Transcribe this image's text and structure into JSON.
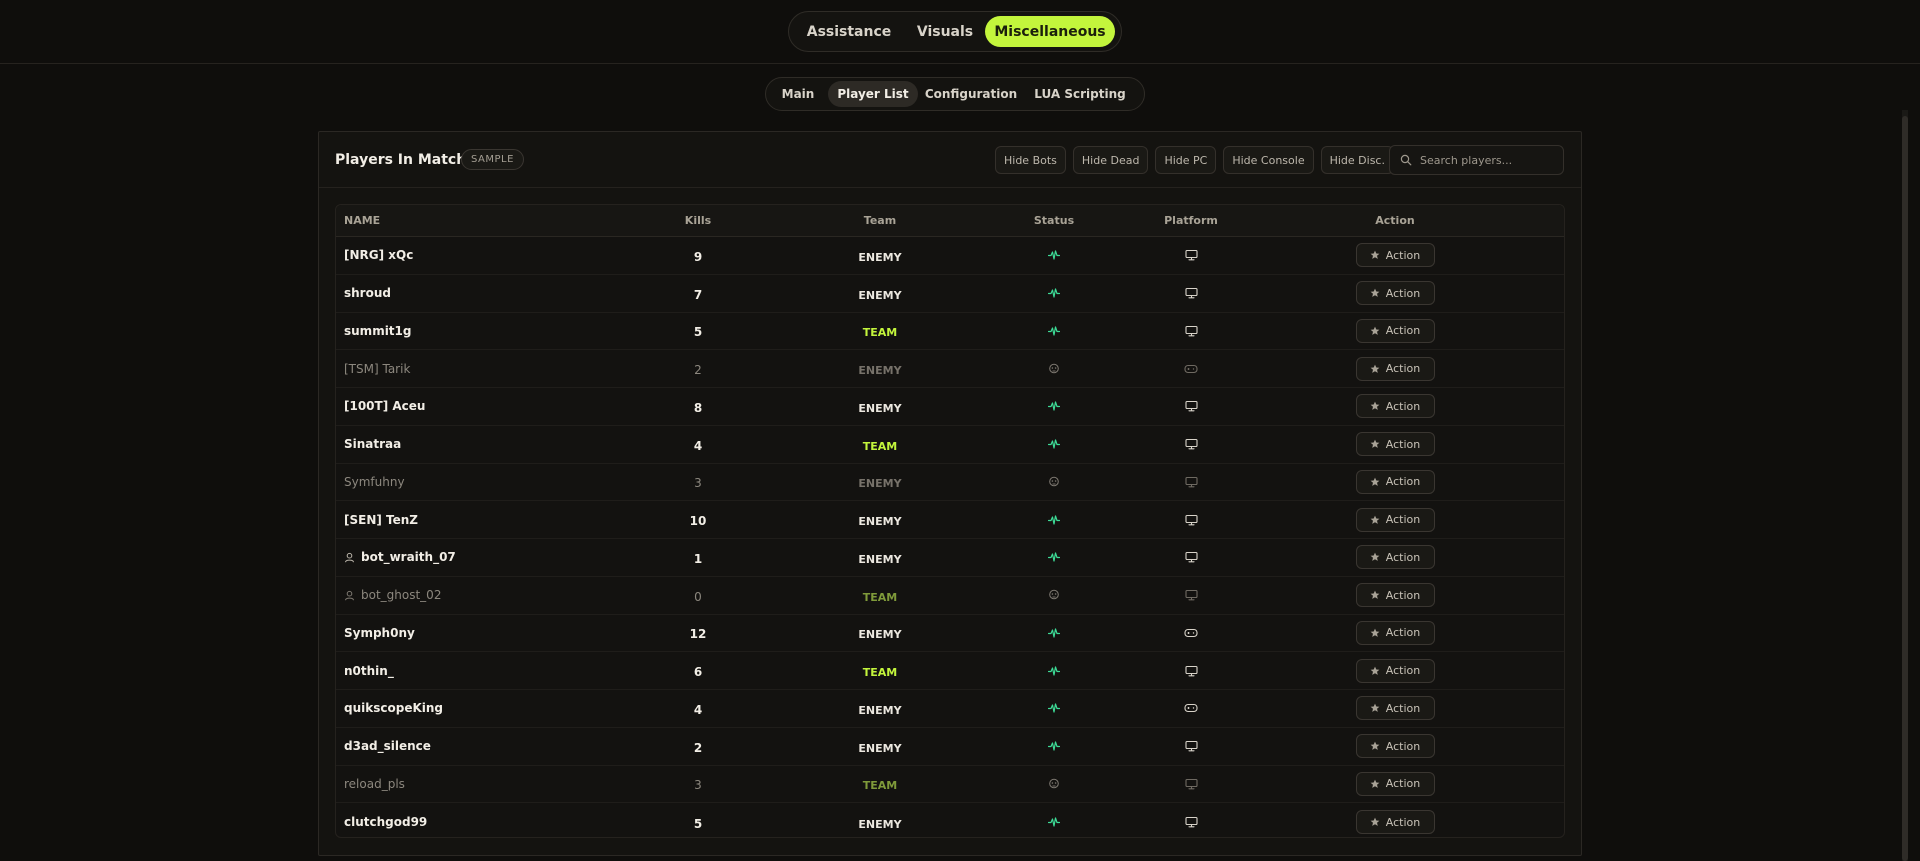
{
  "top_tabs": [
    {
      "label": "Assistance",
      "active": false
    },
    {
      "label": "Visuals",
      "active": false
    },
    {
      "label": "Miscellaneous",
      "active": true
    }
  ],
  "sub_tabs": [
    {
      "label": "Main",
      "active": false
    },
    {
      "label": "Player List",
      "active": true
    },
    {
      "label": "Configuration",
      "active": false
    },
    {
      "label": "LUA Scripting",
      "active": false
    }
  ],
  "panel": {
    "title": "Players In Match",
    "badge": "SAMPLE",
    "filters": [
      "Hide Bots",
      "Hide Dead",
      "Hide PC",
      "Hide Console",
      "Hide Disc."
    ],
    "search_placeholder": "Search players..."
  },
  "table": {
    "headers": {
      "name": "NAME",
      "kills": "Kills",
      "team": "Team",
      "status": "Status",
      "platform": "Platform",
      "action": "Action"
    },
    "action_label": "Action",
    "rows": [
      {
        "name": "[NRG] xQc",
        "kills": "9",
        "team": "ENEMY",
        "status": "alive",
        "platform": "pc",
        "bot": false
      },
      {
        "name": "shroud",
        "kills": "7",
        "team": "ENEMY",
        "status": "alive",
        "platform": "pc",
        "bot": false
      },
      {
        "name": "summit1g",
        "kills": "5",
        "team": "TEAM",
        "status": "alive",
        "platform": "pc",
        "bot": false
      },
      {
        "name": "[TSM] Tarik",
        "kills": "2",
        "team": "ENEMY",
        "status": "dead",
        "platform": "console",
        "bot": false
      },
      {
        "name": "[100T] Aceu",
        "kills": "8",
        "team": "ENEMY",
        "status": "alive",
        "platform": "pc",
        "bot": false
      },
      {
        "name": "Sinatraa",
        "kills": "4",
        "team": "TEAM",
        "status": "alive",
        "platform": "pc",
        "bot": false
      },
      {
        "name": "Symfuhny",
        "kills": "3",
        "team": "ENEMY",
        "status": "dead",
        "platform": "pc",
        "bot": false
      },
      {
        "name": "[SEN] TenZ",
        "kills": "10",
        "team": "ENEMY",
        "status": "alive",
        "platform": "pc",
        "bot": false
      },
      {
        "name": "bot_wraith_07",
        "kills": "1",
        "team": "ENEMY",
        "status": "alive",
        "platform": "pc",
        "bot": true
      },
      {
        "name": "bot_ghost_02",
        "kills": "0",
        "team": "TEAM",
        "status": "dead",
        "platform": "pc",
        "bot": true
      },
      {
        "name": "Symph0ny",
        "kills": "12",
        "team": "ENEMY",
        "status": "alive",
        "platform": "console",
        "bot": false
      },
      {
        "name": "n0thin_",
        "kills": "6",
        "team": "TEAM",
        "status": "alive",
        "platform": "pc",
        "bot": false
      },
      {
        "name": "quikscopeKing",
        "kills": "4",
        "team": "ENEMY",
        "status": "alive",
        "platform": "console",
        "bot": false
      },
      {
        "name": "d3ad_silence",
        "kills": "2",
        "team": "ENEMY",
        "status": "alive",
        "platform": "pc",
        "bot": false
      },
      {
        "name": "reload_pls",
        "kills": "3",
        "team": "TEAM",
        "status": "dead",
        "platform": "pc",
        "bot": false
      },
      {
        "name": "clutchgod99",
        "kills": "5",
        "team": "ENEMY",
        "status": "alive",
        "platform": "pc",
        "bot": false
      }
    ]
  },
  "icons": {
    "status_alive": "heartbeat-icon",
    "status_dead": "skull-icon",
    "platform_pc": "monitor-icon",
    "platform_console": "gamepad-icon",
    "bot": "user-icon",
    "action": "star-icon",
    "search": "search-icon"
  },
  "colors": {
    "accent": "#c3f53c",
    "alive": "#3ddc97",
    "background": "#0f0e0c",
    "panel": "#141310"
  }
}
